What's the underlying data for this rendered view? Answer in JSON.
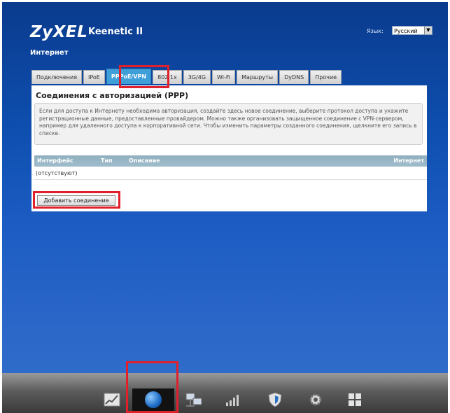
{
  "header": {
    "brand": "ZyXEL",
    "model": "Keenetic II",
    "language_label": "Язык:",
    "language_value": "Русский"
  },
  "section_title": "Интернет",
  "tabs": [
    {
      "label": "Подключения"
    },
    {
      "label": "IPoE"
    },
    {
      "label": "PPPoE/VPN",
      "active": true
    },
    {
      "label": "802.1x"
    },
    {
      "label": "3G/4G"
    },
    {
      "label": "Wi-Fi"
    },
    {
      "label": "Маршруты"
    },
    {
      "label": "DyDNS"
    },
    {
      "label": "Прочие"
    }
  ],
  "panel": {
    "title": "Соединения с авторизацией (PPP)",
    "description": "Если для доступа к Интернету необходима авторизация, создайте здесь новое соединение, выберите протокол доступа и укажите регистрационные данные, предоставленные провайдером. Можно также организовать защищенное соединение с VPN-сервером, например для удаленного доступа к корпоративной сети. Чтобы изменить параметры созданного соединения, щелкните его запись в списке.",
    "table": {
      "columns": [
        "Интерфейс",
        "Тип",
        "Описание",
        "Интернет"
      ],
      "empty_text": "(отсутствуют)"
    },
    "add_button": "Добавить соединение"
  },
  "dock": {
    "items": [
      {
        "icon": "chart-icon"
      },
      {
        "icon": "globe-icon",
        "active": true
      },
      {
        "icon": "network-icon"
      },
      {
        "icon": "signal-icon"
      },
      {
        "icon": "shield-icon"
      },
      {
        "icon": "gear-icon"
      },
      {
        "icon": "grid-icon"
      }
    ]
  }
}
